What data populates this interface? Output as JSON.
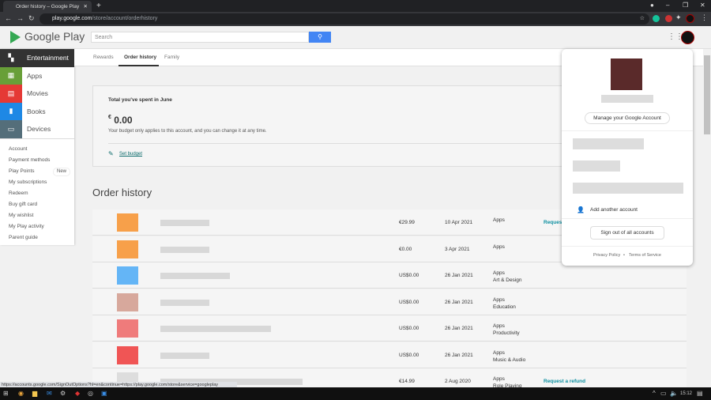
{
  "browser": {
    "tab_title": "Order history – Google Play",
    "url_host": "play.google.com",
    "url_path": "/store/account/orderhistory"
  },
  "header": {
    "logo": "Google Play",
    "search_placeholder": "Search"
  },
  "sidebar": {
    "categories": [
      {
        "label": "Entertainment",
        "color": "#333333",
        "icon": "grid-icon"
      },
      {
        "label": "Apps",
        "color": "#689f38",
        "icon": "apps-icon"
      },
      {
        "label": "Movies",
        "color": "#e53935",
        "icon": "film-icon"
      },
      {
        "label": "Books",
        "color": "#1e88e5",
        "icon": "book-icon"
      },
      {
        "label": "Devices",
        "color": "#546e7a",
        "icon": "device-icon"
      }
    ],
    "links": [
      "Account",
      "Payment methods",
      "Play Points",
      "My subscriptions",
      "Redeem",
      "Buy gift card",
      "My wishlist",
      "My Play activity",
      "Parent guide"
    ],
    "new_badge": "New"
  },
  "subtabs": [
    "Rewards",
    "Order history",
    "Family"
  ],
  "budget": {
    "title": "Total you've spent in June",
    "currency": "€",
    "amount": "0.00",
    "note": "Your budget only applies to this account, and you can change it at any time.",
    "set_budget": "Set budget"
  },
  "order_history": {
    "title": "Order history",
    "rows": [
      {
        "price": "€29.99",
        "date": "10 Apr 2021",
        "category": "Apps",
        "subcategory": "",
        "refund": "Request",
        "thumb": "#f7a04a"
      },
      {
        "price": "€0.00",
        "date": "3 Apr 2021",
        "category": "Apps",
        "subcategory": "",
        "refund": "",
        "thumb": "#f7a04a"
      },
      {
        "price": "US$0.00",
        "date": "26 Jan 2021",
        "category": "Apps",
        "subcategory": "Art & Design",
        "refund": "",
        "thumb": "#64b5f6"
      },
      {
        "price": "US$0.00",
        "date": "26 Jan 2021",
        "category": "Apps",
        "subcategory": "Education",
        "refund": "",
        "thumb": "#d7a89c"
      },
      {
        "price": "US$0.00",
        "date": "26 Jan 2021",
        "category": "Apps",
        "subcategory": "Productivity",
        "refund": "",
        "thumb": "#ef7b7b"
      },
      {
        "price": "US$0.00",
        "date": "26 Jan 2021",
        "category": "Apps",
        "subcategory": "Music & Audio",
        "refund": "",
        "thumb": "#f05555"
      },
      {
        "price": "€14.99",
        "date": "2 Aug 2020",
        "category": "Apps",
        "subcategory": "Role Playing",
        "refund": "Request a refund",
        "thumb": "#dddddd"
      }
    ]
  },
  "account_popup": {
    "manage": "Manage your Google Account",
    "add": "Add another account",
    "signout": "Sign out of all accounts",
    "privacy": "Privacy Policy",
    "terms": "Terms of Service"
  },
  "status_url": "https://accounts.google.com/SignOutOptions?hl=en&continue=https://play.google.com/store&service=googleplay",
  "taskbar": {
    "time": "15:12"
  }
}
